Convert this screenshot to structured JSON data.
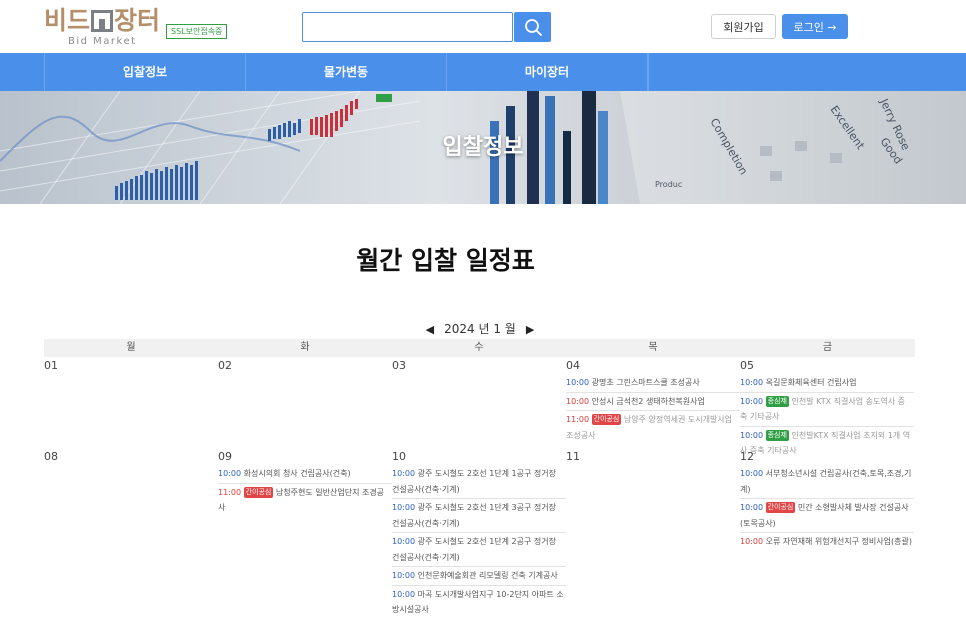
{
  "header": {
    "logo_text": "비드장터",
    "logo_text_a": "비드",
    "logo_text_b": "장터",
    "logo_subtitle": "Bid Market",
    "ssl_badge": "SSL보안접속중",
    "search_placeholder": "",
    "join_label": "회원가입",
    "login_label": "로그인 →"
  },
  "nav": {
    "items": [
      {
        "label": "입찰정보"
      },
      {
        "label": "물가변동"
      },
      {
        "label": "마이장터"
      }
    ]
  },
  "banner": {
    "title": "입찰정보"
  },
  "page_title": "월간 입찰 일정표",
  "calendar": {
    "prev_arrow": "◀",
    "next_arrow": "▶",
    "month_label": "2024 년 1 월",
    "weekdays": [
      "월",
      "화",
      "수",
      "목",
      "금"
    ],
    "weeks": [
      {
        "days": [
          {
            "date": "01",
            "events": []
          },
          {
            "date": "02",
            "events": []
          },
          {
            "date": "03",
            "events": []
          },
          {
            "date": "04",
            "events": [
              {
                "time": "10:00",
                "time_color": "blue",
                "tag": "",
                "title": "광명초 그린스마트스쿨 조성공사",
                "muted": false
              },
              {
                "time": "10:00",
                "time_color": "red",
                "tag": "",
                "title": "안성시 금석천2 생태하천복원사업",
                "muted": false
              },
              {
                "time": "11:00",
                "time_color": "red",
                "tag": "간이공심",
                "tag_color": "red",
                "title": "남양주 양정역세권 도시개발사업 조성공사",
                "muted": true
              }
            ]
          },
          {
            "date": "05",
            "events": [
              {
                "time": "10:00",
                "time_color": "blue",
                "tag": "",
                "title": "옥길문화체육센터 건립사업",
                "muted": false
              },
              {
                "time": "10:00",
                "time_color": "blue",
                "tag": "종심제",
                "tag_color": "green",
                "title": "인천발 KTX 직결사업 송도역사 증축 기타공사",
                "muted": true
              },
              {
                "time": "10:00",
                "time_color": "blue",
                "tag": "종심제",
                "tag_color": "green",
                "title": "인천발KTX 직결사업 초지외 1개 역사 증축 기타공사",
                "muted": true
              }
            ]
          }
        ]
      },
      {
        "days": [
          {
            "date": "08",
            "events": []
          },
          {
            "date": "09",
            "events": [
              {
                "time": "10:00",
                "time_color": "blue",
                "tag": "",
                "title": "화성시의회 청사 건립공사(건축)",
                "muted": false
              },
              {
                "time": "11:00",
                "time_color": "red",
                "tag": "간이공심",
                "tag_color": "red",
                "title": "남청주현도 일반산업단지 조경공사",
                "muted": false
              }
            ]
          },
          {
            "date": "10",
            "events": [
              {
                "time": "10:00",
                "time_color": "blue",
                "tag": "",
                "title": "광주 도시철도 2호선 1단계 1공구 정거장 건설공사(건축·기계)",
                "muted": false
              },
              {
                "time": "10:00",
                "time_color": "blue",
                "tag": "",
                "title": "광주 도시철도 2호선 1단계 3공구 정거장 건설공사(건축·기계)",
                "muted": false
              },
              {
                "time": "10:00",
                "time_color": "blue",
                "tag": "",
                "title": "광주 도시철도 2호선 1단계 2공구 정거장 건설공사(건축·기계)",
                "muted": false
              },
              {
                "time": "10:00",
                "time_color": "blue",
                "tag": "",
                "title": "인천문화예술회관 리모델링 건축 기계공사",
                "muted": false
              },
              {
                "time": "10:00",
                "time_color": "blue",
                "tag": "",
                "title": "마곡 도시개발사업지구 10-2단지 아파트 소방시설공사",
                "muted": false
              }
            ]
          },
          {
            "date": "11",
            "events": []
          },
          {
            "date": "12",
            "events": [
              {
                "time": "10:00",
                "time_color": "blue",
                "tag": "",
                "title": "서부청소년시설 건립공사(건축,토목,조경,기계)",
                "muted": false
              },
              {
                "time": "10:00",
                "time_color": "blue",
                "tag": "간이공심",
                "tag_color": "red",
                "title": "민간 소형발사체 발사장 건설공사(토목공사)",
                "muted": false
              },
              {
                "time": "10:00",
                "time_color": "red",
                "tag": "",
                "title": "오류 자연재해 위험개선지구 정비사업(총괄)",
                "muted": false
              }
            ]
          }
        ]
      }
    ]
  },
  "colors": {
    "accent": "#4a8fea",
    "logo_brown": "#b58f6a",
    "ssl_green": "#2f9e44",
    "tag_red": "#e14545"
  }
}
